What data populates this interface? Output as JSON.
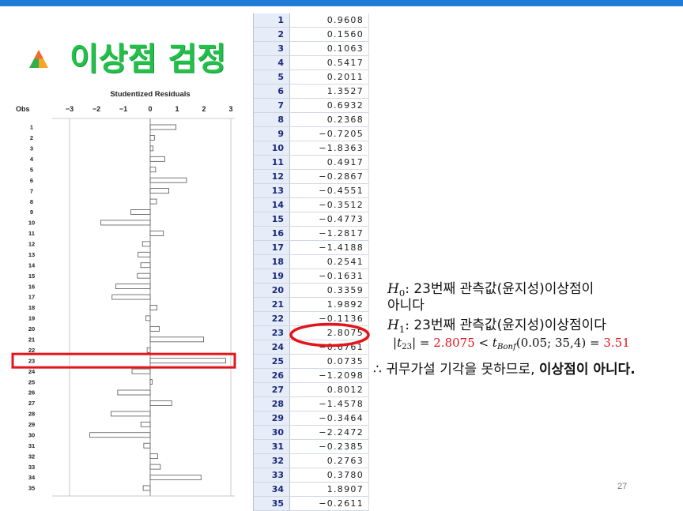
{
  "slide": {
    "accent_color": "#1e7bd6",
    "title": "이상점 검정",
    "title_color": "#22c04a",
    "title_icon": "tricolor-triangle-icon",
    "page_number": "27"
  },
  "chart_data": {
    "type": "bar",
    "orientation": "horizontal",
    "title": "Studentized Residuals",
    "category_label": "Obs",
    "categories": [
      "1",
      "2",
      "3",
      "4",
      "5",
      "6",
      "7",
      "8",
      "9",
      "10",
      "11",
      "12",
      "13",
      "14",
      "15",
      "16",
      "17",
      "18",
      "19",
      "20",
      "21",
      "22",
      "23",
      "24",
      "25",
      "26",
      "27",
      "28",
      "29",
      "30",
      "31",
      "32",
      "33",
      "34",
      "35"
    ],
    "values": [
      0.9608,
      0.156,
      0.1063,
      0.5417,
      0.2011,
      1.3527,
      0.6932,
      0.2368,
      -0.7205,
      -1.8363,
      0.4917,
      -0.2867,
      -0.4551,
      -0.3512,
      -0.4773,
      -1.2817,
      -1.4188,
      0.2541,
      -0.1631,
      0.3359,
      1.9892,
      -0.1136,
      2.8075,
      -0.6761,
      0.0735,
      -1.2098,
      0.8012,
      -1.4578,
      -0.3464,
      -2.2472,
      -0.2385,
      0.2763,
      0.378,
      1.8907,
      -0.2611
    ],
    "xlim": [
      -3,
      3
    ],
    "ticks": [
      -3,
      -2,
      -1,
      0,
      1,
      2,
      3
    ],
    "tick_labels": [
      "−3",
      "−2",
      "−1",
      "0",
      "1",
      "2",
      "3"
    ],
    "reference_lines": [
      -3,
      0,
      3
    ],
    "grid": false,
    "bar_fill": "#ffffff",
    "bar_outline": "#555555",
    "highlight_obs": 23,
    "highlight_color": "#e3141b"
  },
  "residual_table": {
    "rows": [
      {
        "obs": "1",
        "value": "0.9608"
      },
      {
        "obs": "2",
        "value": "0.1560"
      },
      {
        "obs": "3",
        "value": "0.1063"
      },
      {
        "obs": "4",
        "value": "0.5417"
      },
      {
        "obs": "5",
        "value": "0.2011"
      },
      {
        "obs": "6",
        "value": "1.3527"
      },
      {
        "obs": "7",
        "value": "0.6932"
      },
      {
        "obs": "8",
        "value": "0.2368"
      },
      {
        "obs": "9",
        "value": "−0.7205"
      },
      {
        "obs": "10",
        "value": "−1.8363"
      },
      {
        "obs": "11",
        "value": "0.4917"
      },
      {
        "obs": "12",
        "value": "−0.2867"
      },
      {
        "obs": "13",
        "value": "−0.4551"
      },
      {
        "obs": "14",
        "value": "−0.3512"
      },
      {
        "obs": "15",
        "value": "−0.4773"
      },
      {
        "obs": "16",
        "value": "−1.2817"
      },
      {
        "obs": "17",
        "value": "−1.4188"
      },
      {
        "obs": "18",
        "value": "0.2541"
      },
      {
        "obs": "19",
        "value": "−0.1631"
      },
      {
        "obs": "20",
        "value": "0.3359"
      },
      {
        "obs": "21",
        "value": "1.9892"
      },
      {
        "obs": "22",
        "value": "−0.1136"
      },
      {
        "obs": "23",
        "value": "2.8075"
      },
      {
        "obs": "24",
        "value": "−0.6761"
      },
      {
        "obs": "25",
        "value": "0.0735"
      },
      {
        "obs": "26",
        "value": "−1.2098"
      },
      {
        "obs": "27",
        "value": "0.8012"
      },
      {
        "obs": "28",
        "value": "−1.4578"
      },
      {
        "obs": "29",
        "value": "−0.3464"
      },
      {
        "obs": "30",
        "value": "−2.2472"
      },
      {
        "obs": "31",
        "value": "−0.2385"
      },
      {
        "obs": "32",
        "value": "0.2763"
      },
      {
        "obs": "33",
        "value": "0.3780"
      },
      {
        "obs": "34",
        "value": "1.8907"
      },
      {
        "obs": "35",
        "value": "−0.2611"
      }
    ],
    "highlight_row": 23,
    "highlight_color": "#e3141b"
  },
  "hypotheses": {
    "h0": {
      "symbol": "H",
      "sub": "0",
      "sep": ":",
      "line1": "23번째 관측값(윤지성)이상점이",
      "line2": "아니다"
    },
    "h1": {
      "symbol": "H",
      "sub": "1",
      "sep": ":",
      "text": "23번째 관측값(윤지성)이상점이다"
    }
  },
  "test": {
    "abs_open": "|",
    "symbol": "t",
    "sub": "23",
    "abs_close": "|",
    "equals": "=",
    "observed": "2.8075",
    "less_than": "<",
    "critical_symbol": "t",
    "critical_sub": "Bonf",
    "critical_args": "(0.05; 35,4)",
    "equals2": "=",
    "critical_value": "3.51",
    "value_color": "#e3141b"
  },
  "conclusion": {
    "therefore": "∴",
    "text": "귀무가설 기각을 못하므로,",
    "emphasis": "이상점이 아니다."
  }
}
